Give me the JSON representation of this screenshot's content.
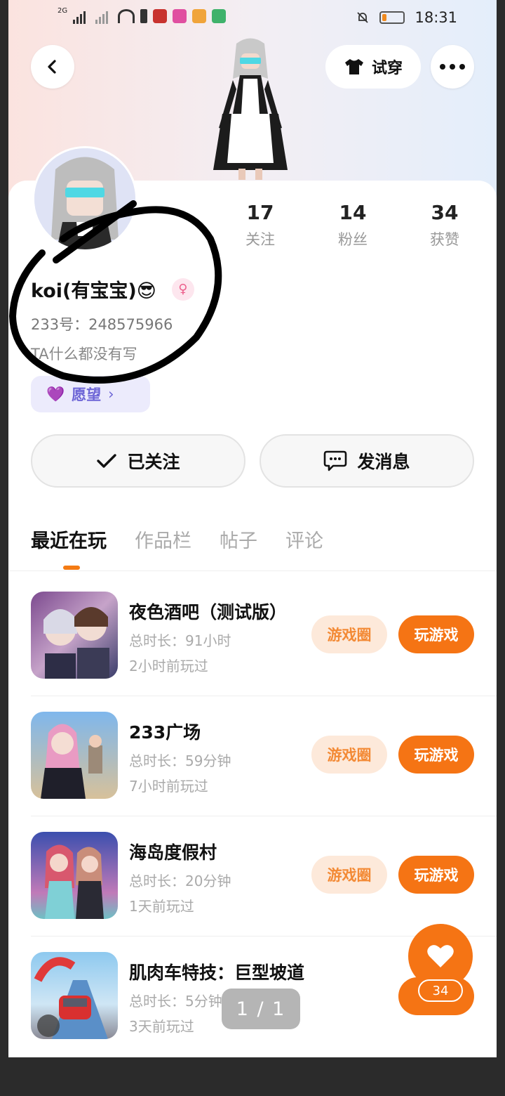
{
  "status_bar": {
    "network_1": "2G",
    "time": "18:31",
    "battery_level_percent": 20
  },
  "header": {
    "back_icon": "chevron-left-icon",
    "try_on_label": "试穿",
    "try_on_icon": "tshirt-icon",
    "more_icon": "more-dots-icon"
  },
  "profile": {
    "stats": [
      {
        "value": "17",
        "label": "关注"
      },
      {
        "value": "14",
        "label": "粉丝"
      },
      {
        "value": "34",
        "label": "获赞"
      }
    ],
    "nickname": "koi(有宝宝)😎",
    "gender_icon": "female-symbol-icon",
    "uid": "233号：248575966",
    "bio": "TA什么都没有写",
    "wish_label": "愿望",
    "follow_label": "已关注",
    "message_label": "发消息"
  },
  "tabs": [
    {
      "label": "最近在玩",
      "active": true
    },
    {
      "label": "作品栏",
      "active": false
    },
    {
      "label": "帖子",
      "active": false
    },
    {
      "label": "评论",
      "active": false
    }
  ],
  "games": [
    {
      "name": "夜色酒吧（测试版）",
      "duration": "总时长：91小时",
      "last_played": "2小时前玩过",
      "circle_label": "游戏圈",
      "play_label": "玩游戏"
    },
    {
      "name": "233广场",
      "duration": "总时长：59分钟",
      "last_played": "7小时前玩过",
      "circle_label": "游戏圈",
      "play_label": "玩游戏"
    },
    {
      "name": "海岛度假村",
      "duration": "总时长：20分钟",
      "last_played": "1天前玩过",
      "circle_label": "游戏圈",
      "play_label": "玩游戏"
    },
    {
      "name": "肌肉车特技：巨型坡道",
      "duration": "总时长：5分钟",
      "last_played": "3天前玩过",
      "circle_label": "",
      "play_label": ""
    }
  ],
  "like_fab": {
    "icon": "heart-icon",
    "count": "34"
  },
  "image_pager": "1 / 1",
  "colors": {
    "accent": "#f57414",
    "accent_light": "#fde9da",
    "wish_bg": "#ecebfc",
    "gender_pink": "#ec5f8c"
  }
}
